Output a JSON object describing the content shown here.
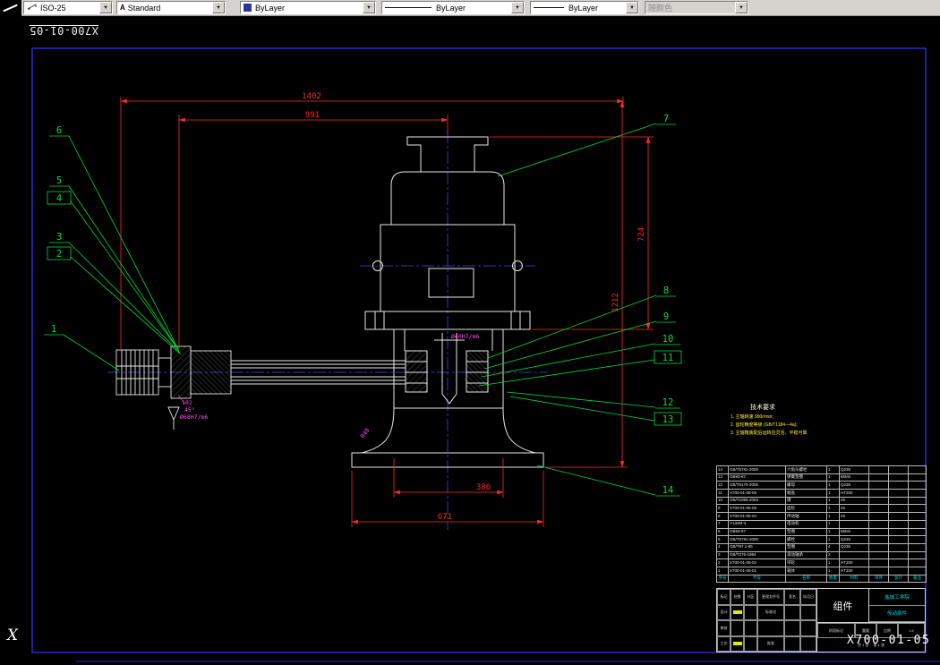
{
  "toolbar": {
    "dim_style": "ISO-25",
    "text_style": "Standard",
    "color": "ByLayer",
    "linetype": "ByLayer",
    "lineweight": "ByLayer",
    "plot_style": "随颜色"
  },
  "stamps": {
    "corner": "X700-01-05",
    "bottom_right": "X700-01-05",
    "ucs": "X"
  },
  "dimensions": {
    "overall_width": "1402",
    "upper_width": "991",
    "motor_height": "724",
    "overall_height": "1212",
    "column_width": "386",
    "base_width": "671",
    "shaft_fit": "Ø40H7/m6",
    "hub_length": "102",
    "chamfer": "45°",
    "hub_fit": "Ø68H7/m6",
    "fillet": "R40"
  },
  "balloons": {
    "b1": "1",
    "b2": "2",
    "b3": "3",
    "b4": "4",
    "b5": "5",
    "b6": "6",
    "b7": "7",
    "b8": "8",
    "b9": "9",
    "b10": "10",
    "b11": "11",
    "b12": "12",
    "b13": "13",
    "b14": "14"
  },
  "tech": {
    "title": "技术要求",
    "line1": "1. 主轴转速 900r/min;",
    "line2": "2. 齿轮精度等级 (GB/T1184—4a);",
    "line3": "3. 主轴箱装配后运转应灵活、平稳可靠"
  },
  "bom": {
    "header": [
      "序号",
      "代号",
      "名称",
      "数量",
      "材料",
      "单件",
      "总计",
      "备注"
    ],
    "rows": [
      [
        "14",
        "GB/T5781-2000",
        "六角头螺栓",
        "1",
        "Q235",
        "",
        "",
        ""
      ],
      [
        "13",
        "GB93-87",
        "弹簧垫圈",
        "1",
        "65Mn",
        "",
        "",
        ""
      ],
      [
        "12",
        "GB/T6170-2000",
        "螺母",
        "1",
        "Q235",
        "",
        "",
        ""
      ],
      [
        "11",
        "X700-01-05-06",
        "端盖",
        "1",
        "HT200",
        "",
        "",
        ""
      ],
      [
        "10",
        "GB/T1096-2003",
        "键",
        "1",
        "45",
        "",
        "",
        ""
      ],
      [
        "9",
        "X700-01-05-05",
        "齿轮",
        "1",
        "45",
        "",
        "",
        ""
      ],
      [
        "8",
        "X700-01-05-04",
        "传动轴",
        "1",
        "45",
        "",
        "",
        ""
      ],
      [
        "7",
        "Y132M-4",
        "电动机",
        "1",
        "",
        "",
        "",
        ""
      ],
      [
        "6",
        "GB93-87",
        "垫圈",
        "1",
        "65Mn",
        "",
        "",
        ""
      ],
      [
        "5",
        "GB/T5781-2000",
        "螺栓",
        "1",
        "Q235",
        "",
        "",
        ""
      ],
      [
        "4",
        "GB/T97.1-85",
        "垫圈",
        "4",
        "Q235",
        "",
        "",
        ""
      ],
      [
        "3",
        "GB/T276-1994",
        "滚动轴承",
        "2",
        "",
        "",
        "",
        ""
      ],
      [
        "2",
        "X700-01-05-02",
        "带轮",
        "1",
        "HT200",
        "",
        "",
        ""
      ],
      [
        "1",
        "X700-01-05-01",
        "箱体",
        "1",
        "HT200",
        "",
        "",
        ""
      ]
    ]
  },
  "titleblock": {
    "mark": "标记",
    "count": "处数",
    "zone": "分区",
    "doc": "更改文件号",
    "sign": "签名",
    "date": "年月日",
    "design": "设计",
    "std": "标准化",
    "check": "审核",
    "proc": "工艺",
    "appr": "批准",
    "stage": "阶段标记",
    "weight": "重量",
    "scale_label": "比例",
    "scale": "1:4",
    "part_name": "组件",
    "school": "盐城工学院",
    "assembly": "传动部件",
    "sheet_total": "共 1 张",
    "sheet_no": "第 1 张"
  }
}
